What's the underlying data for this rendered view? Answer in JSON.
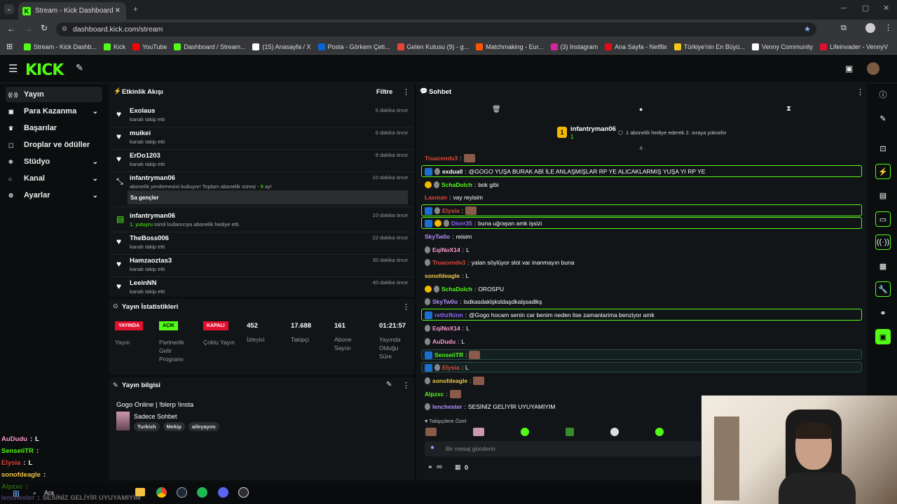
{
  "browser": {
    "tab_title": "Stream - Kick Dashboard",
    "url": "dashboard.kick.com/stream",
    "bookmarks": [
      {
        "label": "Stream - Kick Dashb...",
        "color": "#53fc18"
      },
      {
        "label": "Kick",
        "color": "#53fc18"
      },
      {
        "label": "YouTube",
        "color": "#ff0000"
      },
      {
        "label": "Dashboard / Stream...",
        "color": "#53fc18"
      },
      {
        "label": "(15) Anasayfa / X",
        "color": "#ffffff"
      },
      {
        "label": "Posta - Görkem Çeti...",
        "color": "#0a64d6"
      },
      {
        "label": "Gelen Kutusu (9) - g...",
        "color": "#ea4335"
      },
      {
        "label": "Matchmaking - Eur...",
        "color": "#ff5500"
      },
      {
        "label": "(3) Instagram",
        "color": "#d6249f"
      },
      {
        "label": "Ana Sayfa - Netflix",
        "color": "#e50914"
      },
      {
        "label": "Türkiye'nin En Büyü...",
        "color": "#f5c518"
      },
      {
        "label": "Venny Community",
        "color": "#ffffff"
      },
      {
        "label": "Lifeinvader - VennyV",
        "color": "#e0102f"
      }
    ]
  },
  "kick": {
    "logo": "KICK"
  },
  "sidebar": {
    "items": [
      {
        "label": "Yayın",
        "icon": "broadcast-icon"
      },
      {
        "label": "Para Kazanma",
        "icon": "money-icon"
      },
      {
        "label": "Başarılar",
        "icon": "trophy-icon"
      },
      {
        "label": "Droplar ve ödüller",
        "icon": "gift-icon"
      },
      {
        "label": "Stüdyo",
        "icon": "gear-icon"
      },
      {
        "label": "Kanal",
        "icon": "house-icon"
      },
      {
        "label": "Ayarlar",
        "icon": "settings-icon"
      }
    ]
  },
  "activity": {
    "title": "Etkinlik Akışı",
    "filter": "Filtre",
    "items": [
      {
        "name": "Exolaus",
        "sub": "kanalı takip etti",
        "time": "5 dakika önce"
      },
      {
        "name": "muikei",
        "sub": "kanalı takip etti",
        "time": "6 dakika önce"
      },
      {
        "name": "ErDo1203",
        "sub": "kanalı takip etti",
        "time": "9 dakika önce"
      },
      {
        "name": "infantryman06",
        "sub_a": "abonelik yenilemesini kutluyor! Toplam abonelik süresi - ",
        "sub_b": "9",
        "sub_c": " ay!",
        "msg": "Sa gençler",
        "time": "10 dakika önce"
      },
      {
        "name": "infantryman06",
        "sub_a": "1, yutuyru",
        "sub_b": " isimli kullanıcıya abonelik hediye etti.",
        "time": "10 dakika önce"
      },
      {
        "name": "TheBoss006",
        "sub": "kanalı takip etti",
        "time": "22 dakika önce"
      },
      {
        "name": "Hamzaoztas3",
        "sub": "kanalı takip etti",
        "time": "30 dakika önce"
      },
      {
        "name": "LeeinNN",
        "sub": "kanalı takip etti",
        "time": "40 dakika önce"
      }
    ]
  },
  "stats": {
    "title": "Yayın İstatistikleri",
    "badges": [
      {
        "text": "YAYINDA",
        "label": "Yayın"
      },
      {
        "text": "AÇIK",
        "label": "Partnerlik Gelir Programı"
      },
      {
        "text": "KAPALI",
        "label": "Çoklu Yayın"
      }
    ],
    "numbers": [
      {
        "value": "452",
        "label": "İzleyici"
      },
      {
        "value": "17.688",
        "label": "Takipçi"
      },
      {
        "value": "161",
        "label": "Abone Sayısı"
      },
      {
        "value": "01:21:57",
        "label": "Yayında Olduğu Süre"
      }
    ]
  },
  "info": {
    "title": "Yayın bilgisi",
    "stream_title": "Gogo Online | !blerp !insta",
    "category": "Sadece Sohbet",
    "tags": [
      "Turkish",
      "Mekip",
      "aileyayını"
    ]
  },
  "chat": {
    "title": "Sohbet",
    "pinned_user": "infantryman06",
    "pinned_count": "1",
    "pinned_rank": "1",
    "pinned_text": "1 abonelik hediye ederek 2. sıraya yükselin",
    "messages": [
      {
        "user": "Truacendv3",
        "color": "#e0483a",
        "text": "",
        "emote": true
      },
      {
        "user": "exduall",
        "color": "#ffffff",
        "text": "@GOGO YUŞA BURAK ABİ İLE ANLAŞMIŞLAR RP YE ALICAKLARMIŞ YUŞA YI RP YE",
        "hl": "green"
      },
      {
        "user": "SchaDolch",
        "color": "#53fc18",
        "text": "bok gibi"
      },
      {
        "user": "Lasman",
        "color": "#e0483a",
        "text": "vay reyisim"
      },
      {
        "user": "Elysia",
        "color": "#e0483a",
        "text": "",
        "emote": true,
        "hl": "green"
      },
      {
        "user": "Diorr35",
        "color": "#8d6bff",
        "text": "buna uğraşan amk işsizi",
        "hl": "green"
      },
      {
        "user": "SkyTw0o",
        "color": "#b48cff",
        "text": "reisim"
      },
      {
        "user": "EqiNoX14",
        "color": "#ff9bd0",
        "text": "L"
      },
      {
        "user": "Truacendv3",
        "color": "#e0483a",
        "text": "yalan söylüyor slot var inanmayın buna"
      },
      {
        "user": "sonofdeagle",
        "color": "#f2c94c",
        "text": "L"
      },
      {
        "user": "SchaDolch",
        "color": "#53fc18",
        "text": "OROSPU"
      },
      {
        "user": "SkyTw0o",
        "color": "#b48cff",
        "text": "lsdkasdaklşksldaşdkalşsadlkş"
      },
      {
        "user": "rethzfkinn",
        "color": "#8d6bff",
        "text": "@Gogo hocam senin car benim neden lise zamanlarima benziyor amk",
        "hl": "green"
      },
      {
        "user": "EqiNoX14",
        "color": "#ff9bd0",
        "text": "L"
      },
      {
        "user": "AuDudu",
        "color": "#ff9bd0",
        "text": "L"
      },
      {
        "user": "SenseiiTR",
        "color": "#53fc18",
        "text": "",
        "emote": true,
        "hl": "blue"
      },
      {
        "user": "Elysia",
        "color": "#e0483a",
        "text": "L",
        "hl": "blue"
      },
      {
        "user": "sonofdeagle",
        "color": "#f2c94c",
        "text": "",
        "emote": true
      },
      {
        "user": "Alpzxc",
        "color": "#53fc18",
        "text": "",
        "emote": true
      },
      {
        "user": "lenchester",
        "color": "#b48cff",
        "text": "SESİNİZ GELİYİR UYUYAMIYIM"
      }
    ],
    "followers_only": "Takipçilere Özel",
    "placeholder": "Bir mesaj gönderin",
    "infinity": "∞",
    "count": "0"
  },
  "overlay": {
    "lines": [
      {
        "user": "AuDudu",
        "color": "#ff9bd0",
        "text": "L"
      },
      {
        "user": "SenseiiTR",
        "color": "#53fc18",
        "text": ""
      },
      {
        "user": "Elysia",
        "color": "#e0483a",
        "text": "L"
      },
      {
        "user": "sonofdeagle",
        "color": "#f2c94c",
        "text": ""
      },
      {
        "user": "Alpzxc",
        "color": "#53fc18",
        "text": ""
      },
      {
        "user": "lenchester",
        "color": "#b48cff",
        "text": "SESİNİZ GELİYİR UYUYAMIYIM"
      }
    ],
    "search": "Ara"
  }
}
